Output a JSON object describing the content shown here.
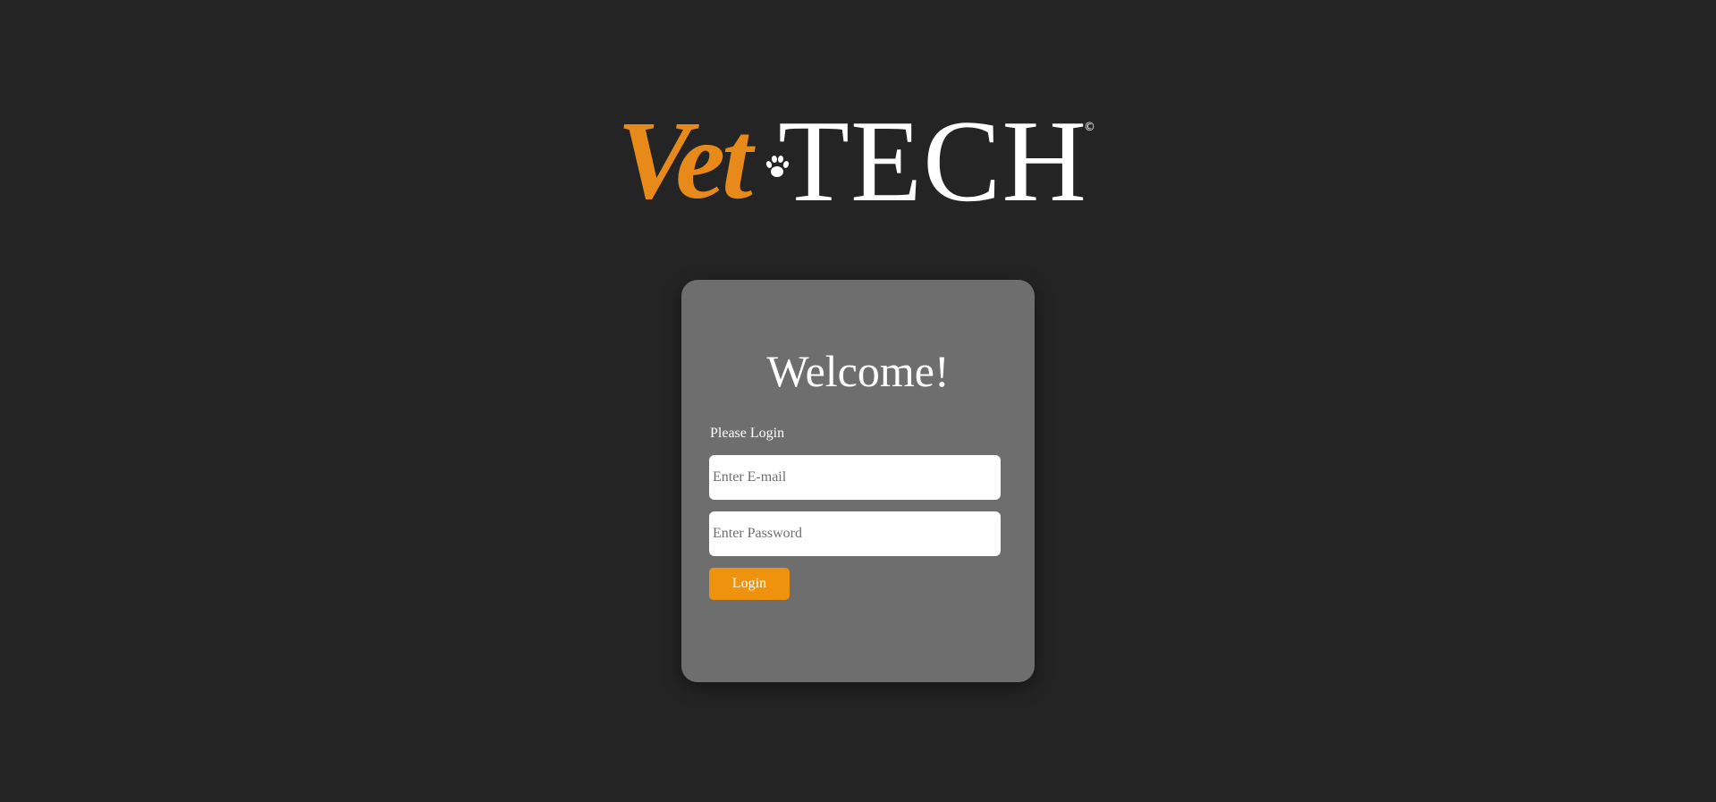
{
  "colors": {
    "background": "#242424",
    "card_background": "#6e6e6e",
    "brand_orange": "#e88a1a",
    "button_orange": "#ef930f",
    "text_white": "#ffffff"
  },
  "logo": {
    "vet_text": "Vet",
    "tech_text": "TECH",
    "copyright_symbol": "©",
    "paw_icon": "paw-icon"
  },
  "login_card": {
    "title": "Welcome!",
    "label": "Please Login",
    "email": {
      "placeholder": "Enter E-mail",
      "value": ""
    },
    "password": {
      "placeholder": "Enter Password",
      "value": ""
    },
    "login_button": "Login"
  }
}
